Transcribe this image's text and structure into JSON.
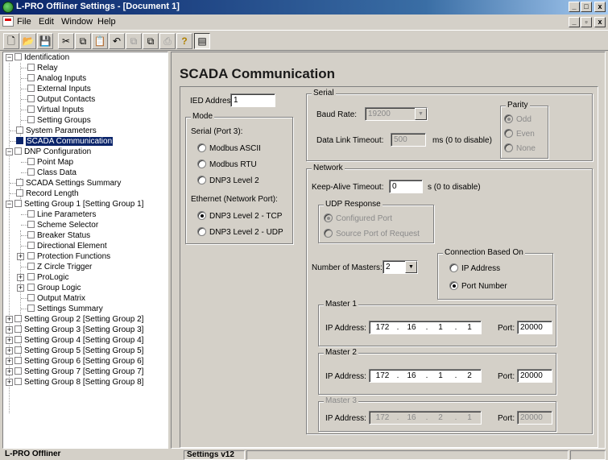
{
  "window": {
    "title": "L-PRO Offliner Settings - [Document 1]",
    "min": "_",
    "max": "□",
    "close": "x"
  },
  "menu": [
    "File",
    "Edit",
    "Window",
    "Help"
  ],
  "mdi": {
    "min": "_",
    "restore": "▫",
    "close": "x"
  },
  "tree": {
    "items": [
      "Identification",
      "Relay",
      "Analog Inputs",
      "External Inputs",
      "Output Contacts",
      "Virtual Inputs",
      "Setting Groups",
      "System Parameters",
      "SCADA Communication",
      "DNP Configuration",
      "Point Map",
      "Class Data",
      "SCADA Settings Summary",
      "Record Length",
      "Setting Group 1 [Setting Group 1]",
      "Line Parameters",
      "Scheme Selector",
      "Breaker Status",
      "Directional Element",
      "Protection Functions",
      "Z Circle Trigger",
      "ProLogic",
      "Group Logic",
      "Output Matrix",
      "Settings Summary",
      "Setting Group 2 [Setting Group 2]",
      "Setting Group 3 [Setting Group 3]",
      "Setting Group 4 [Setting Group 4]",
      "Setting Group 5 [Setting Group 5]",
      "Setting Group 6 [Setting Group 6]",
      "Setting Group 7 [Setting Group 7]",
      "Setting Group 8 [Setting Group 8]"
    ]
  },
  "page": {
    "title": "SCADA Communication"
  },
  "ied": {
    "label": "IED Address:",
    "value": "1"
  },
  "mode": {
    "title": "Mode",
    "serial_label": "Serial (Port 3):",
    "serial_options": [
      "Modbus ASCII",
      "Modbus RTU",
      "DNP3 Level 2"
    ],
    "ethernet_label": "Ethernet (Network Port):",
    "ethernet_options": [
      "DNP3 Level 2 - TCP",
      "DNP3 Level 2 - UDP"
    ]
  },
  "serial": {
    "title": "Serial",
    "baud_label": "Baud Rate:",
    "baud_value": "19200",
    "timeout_label": "Data Link Timeout:",
    "timeout_value": "500",
    "timeout_unit": "ms (0 to disable)",
    "parity_title": "Parity",
    "parity_options": [
      "Odd",
      "Even",
      "None"
    ]
  },
  "network": {
    "title": "Network",
    "keepalive_label": "Keep-Alive Timeout:",
    "keepalive_value": "0",
    "keepalive_unit": "s (0 to disable)",
    "udp_title": "UDP Response",
    "udp_options": [
      "Configured Port",
      "Source Port of Request"
    ],
    "masters_label": "Number of Masters:",
    "masters_value": "2",
    "conn_title": "Connection Based On",
    "conn_options": [
      "IP Address",
      "Port Number"
    ],
    "ip_label": "IP Address:",
    "port_label": "Port:",
    "masters": [
      {
        "title": "Master 1",
        "ip": [
          "172",
          "16",
          "1",
          "1"
        ],
        "port": "20000"
      },
      {
        "title": "Master 2",
        "ip": [
          "172",
          "16",
          "1",
          "2"
        ],
        "port": "20000"
      },
      {
        "title": "Master 3",
        "ip": [
          "172",
          "16",
          "2",
          "1"
        ],
        "port": "20000"
      }
    ]
  },
  "status": {
    "app": "L-PRO Offliner",
    "version": "Settings v12"
  }
}
